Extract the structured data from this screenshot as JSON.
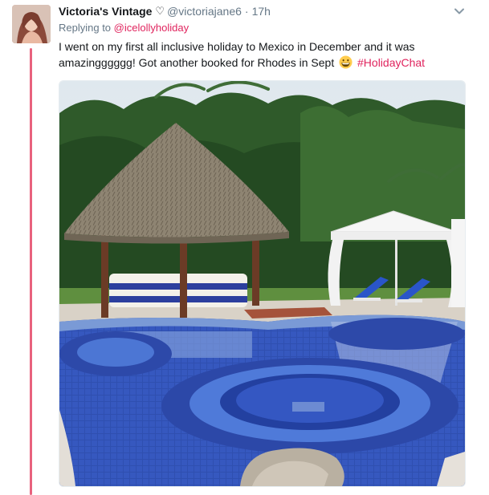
{
  "tweet": {
    "display_name": "Victoria's Vintage",
    "badge": "♡",
    "handle": "@victoriajane6",
    "separator": "·",
    "time": "17h",
    "replying_prefix": "Replying to",
    "replying_to": "@icelollyholiday",
    "text": "I went on my first all inclusive holiday to Mexico in December and it was amazingggggg! Got another booked for Rhodes in Sept",
    "hashtag": "#HolidayChat",
    "emoji": "grinning-face-emoji"
  },
  "icons": {
    "menu": "chevron-down-icon",
    "avatar": "profile-photo",
    "media": "pool-photo"
  },
  "colors": {
    "accent": "#e0245e",
    "thread_line": "#e8627d",
    "secondary_text": "#657786"
  }
}
